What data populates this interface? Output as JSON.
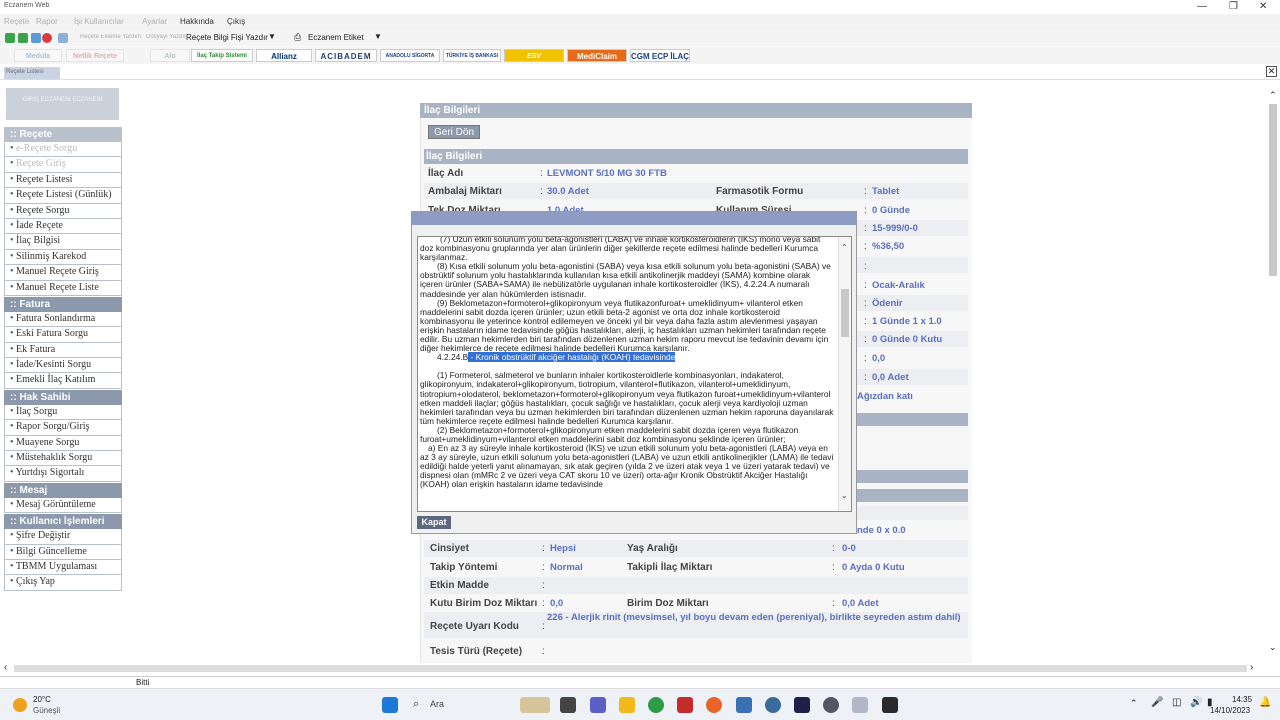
{
  "window": {
    "title": "Eczanem Web"
  },
  "menu": {
    "items": [
      "Reçete",
      "Rapor",
      "İşi Kullanıcılar",
      "Ayarlar",
      "Hakkında",
      "Çıkış"
    ]
  },
  "toolbar": {
    "faded_items": [
      "Reçete Ekleme Yardım",
      "Dosyayı Yazdır"
    ],
    "receipt_print": "Reçete Bilgi Fişi Yazdır",
    "eczanem_etiket": "Eczanem Etiket"
  },
  "logos": [
    "Medula",
    "Netlik Reçete",
    "Alo",
    "İlaç Takip Sistemi",
    "Allianz",
    "ACIBADEM",
    "ANADOLU SİGORTA",
    "TÜRKİYE İŞ BANKASI",
    "ESV",
    "MediClaim",
    "CGM ECP İLAÇ"
  ],
  "tab": {
    "label": "Reçete Listesi"
  },
  "sidebar": {
    "top": "GİRİŞ ECZANESİ ECZANESİ",
    "sections": [
      {
        "title": ":: Reçete",
        "items": [
          "e-Reçete Sorgu",
          "Reçete Giriş",
          "Reçete Listesi",
          "Reçete Listesi (Günlük)",
          "Reçete Sorgu",
          "İade Reçete",
          "İlaç Bilgisi",
          "Silinmiş Karekod",
          "Manuel Reçete Giriş",
          "Manuel Reçete Liste"
        ]
      },
      {
        "title": ":: Fatura",
        "items": [
          "Fatura Sonlandırma",
          "Eski Fatura Sorgu",
          "Ek Fatura",
          "İade/Kesinti Sorgu",
          "Emekli İlaç Katılım"
        ]
      },
      {
        "title": ":: Hak Sahibi",
        "items": [
          "İlaç Sorgu",
          "Rapor Sorgu/Giriş",
          "Muayene Sorgu",
          "Müstehaklık Sorgu",
          "Yurtdışı Sigortalı"
        ]
      },
      {
        "title": ":: Mesaj",
        "items": [
          "Mesaj Görüntüleme"
        ]
      },
      {
        "title": ":: Kullanıcı İşlemleri",
        "items": [
          "Şifre Değiştir",
          "Bilgi Güncelleme",
          "TBMM Uygulaması",
          "Çıkış Yap"
        ]
      }
    ]
  },
  "page": {
    "header": "İlaç Bilgileri",
    "back": "Geri Dön",
    "sub_header": "İlaç Bilgileri"
  },
  "info": {
    "ilac_adi_label": "İlaç Adı",
    "ilac_adi": "LEVMONT 5/10 MG 30 FTB",
    "ambalaj_label": "Ambalaj Miktarı",
    "ambalaj": "30.0 Adet",
    "form_label": "Farmasotik Formu",
    "form": "Tablet",
    "tekdoz_label": "Tek Doz Miktarı",
    "tekdoz": "1.0 Adet",
    "kullanim_label": "Kullanım Süresi",
    "kullanim": "0 Günde",
    "r3": "15-999/0-0",
    "r4": "%36,50",
    "r5": "",
    "r6": "Ocak-Aralık",
    "r7": "Ödenir",
    "r8": "1 Günde 1 x 1.0",
    "r9": "0 Günde 0 Kutu",
    "r10": "0,0",
    "r11": "0,0 Adet",
    "r12": "Ağızdan katı",
    "r13": "nde 0 x 0.0",
    "cinsiyet_label": "Cinsiyet",
    "cinsiyet": "Hepsi",
    "yas_label": "Yaş Aralığı",
    "yas": "0-0",
    "takip_label": "Takip Yöntemi",
    "takip": "Normal",
    "takipli_label": "Takipli İlaç Miktarı",
    "takipli": "0 Ayda 0 Kutu",
    "etken_label": "Etkin Madde",
    "etken": "",
    "kutu_label": "Kutu Birim Doz Miktarı",
    "kutu": "0,0",
    "birim_label": "Birim Doz Miktarı",
    "birim": "0,0 Adet",
    "uyari_label": "Reçete Uyarı Kodu",
    "uyari": "226 - Alerjik rinit (mevsimsel, yıl boyu devam eden (pereniyal), birlikte seyreden astım dahil)",
    "tesis_label": "Tesis Türü (Reçete)"
  },
  "modal": {
    "p1": "(7) Uzun etkili solunum yolu beta-agonistleri (LABA) ve inhale kortikosteroidlerin (İKS) mono veya sabit doz kombinasyonu gruplarında yer alan ürünlerin diğer şekillerde reçete edilmesi halinde bedelleri Kurumca karşılanmaz.",
    "p2": "(8) Kısa etkili solunum yolu beta-agonistini (SABA) veya kısa etkili solunum yolu beta-agonistini (SABA) ve obstrüktif solunum yolu hastalıklarında kullanılan kısa etkili antikolinerjik maddeyi (SAMA) kombine olarak içeren ürünler (SABA+SAMA) ile nebülizatörle uygulanan inhale kortikosteroidler (İKS), 4.2.24.A numaralı maddesinde yer alan hükümlerden istisnadır.",
    "p3": "(9) Beklometazon+formoterol+glikopironyum veya flutikazonfuroat+ umeklidinyum+ vilanterol etken maddelerini sabit dozda içeren ürünler; uzun etkili beta-2 agonist ve orta doz inhale kortikosteroid kombinasyonu ile yeterince kontrol edilemeyen ve önceki yıl bir veya daha fazla astım alevlenmesi yaşayan erişkin hastaların idame tedavisinde göğüs hastalıkları, alerji, iç hastalıkları uzman hekimleri tarafından reçete edilir. Bu uzman hekimlerden biri tarafından düzenlenen uzman hekim raporu mevcut ise tedavinin devamı için diğer hekimlerce de reçete edilmesi halinde bedelleri Kurumca karşılanır.",
    "code": "4.2.24.B",
    "highlight": " - Kronik obstrüktif akciğer hastalığı (KOAH) tedavisinde",
    "p4": "(1) Formeterol, salmeterol ve bunların inhaler kortikosteroidlerle kombinasyonları, indakaterol, glikopironyum, indakaterol+glikopironyum, tiotropium, vilanterol+flutikazon, vilanterol+umeklidinyum, tiotropium+olodaterol, beklometazon+formoterol+glikopironyum veya flutikazon furoat+umeklidinyum+vilanterol etken maddeli ilaçlar; göğüs hastalıkları, çocuk sağlığı ve hastalıkları, çocuk alerji veya kardiyoloji uzman hekimleri tarafından veya bu uzman hekimlerden biri tarafından düzenlenen uzman hekim raporuna dayanılarak tüm hekimlerce reçete edilmesi halinde bedelleri Kurumca karşılanır.",
    "p5": "(2) Beklometazon+formoterol+glikopironyum etken maddelerini sabit dozda içeren veya flutikazon furoat+umeklidinyum+vilanterol etken maddelerini sabit doz kombinasyonu şeklinde içeren ürünler;",
    "p6": "a) En az 3 ay süreyle inhale kortikosteroid (İKS) ve uzun etkili solunum yolu beta-agonistleri (LABA) veya en az 3 ay süreyle, uzun etkili solunum yolu beta-agonistleri (LABA) ve uzun etkili antikolinerjikler (LAMA) ile tedavi edildiği halde yeterli yanıt alınamayan, sık atak geçiren (yılda 2 ve üzeri atak veya 1 ve üzeri yatarak tedavi) ve dispnesi olan (mMRc 2 ve üzeri veya CAT skoru 10 ve üzeri) orta-ağır Kronik Obstrüktif Akciğer Hastalığı (KOAH) olan erişkin hastaların idame tedavisinde",
    "close": "Kapat"
  },
  "status": {
    "text": "Bitti"
  },
  "taskbar": {
    "weather_temp": "20°C",
    "weather_city": "Güneşli",
    "search": "Ara",
    "time": "14:35",
    "date": "14/10/2023"
  }
}
